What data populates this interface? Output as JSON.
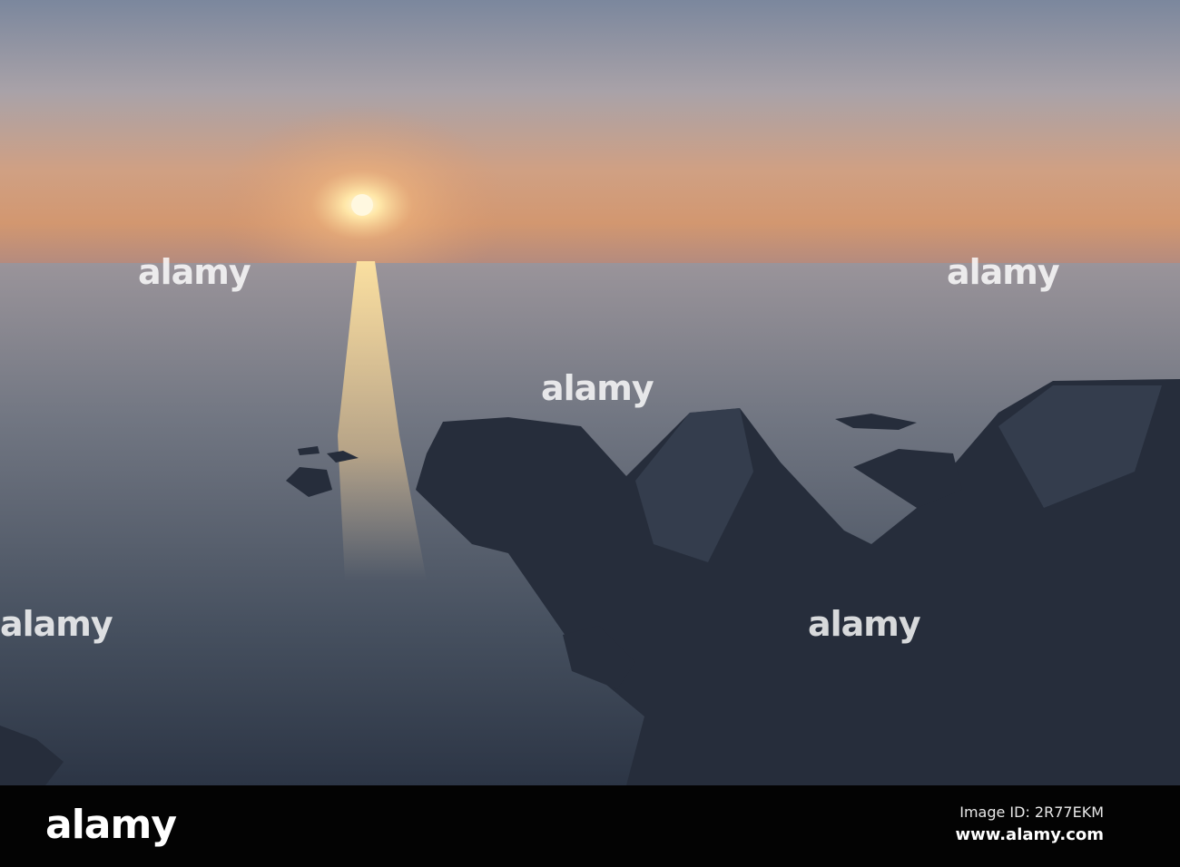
{
  "photo": {
    "subject": "sunset-over-sea-rocky-coast",
    "colors": {
      "sky_top": "#7e8aa0",
      "sky_glow": "#d49a72",
      "sun": "#fff6d8",
      "sea_top": "#8e8e98",
      "sea_bottom": "#2e3848",
      "rock": "#262d3b"
    }
  },
  "watermark": {
    "text": "alamy"
  },
  "footer": {
    "logo": "alamy",
    "image_id": "Image ID: 2R77EKM",
    "site": "www.alamy.com"
  }
}
